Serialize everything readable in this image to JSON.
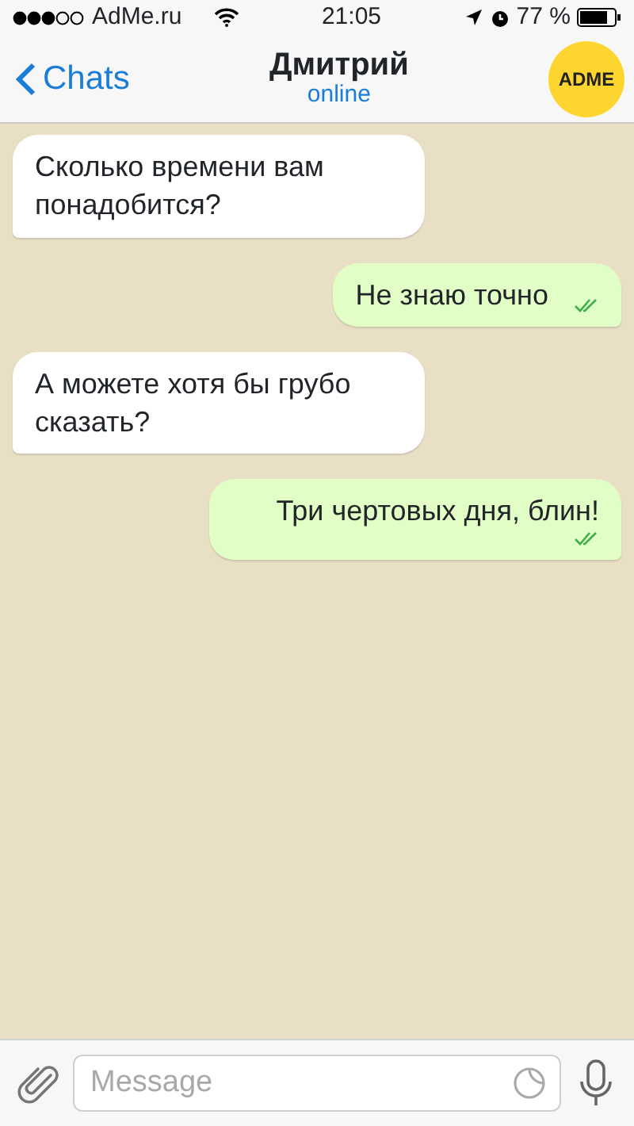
{
  "status_bar": {
    "carrier": "AdMe.ru",
    "time": "21:05",
    "battery": "77 %"
  },
  "nav": {
    "back": "Chats",
    "title": "Дмитрий",
    "subtitle": "online",
    "avatar": "ADME"
  },
  "messages": [
    {
      "kind": "in",
      "text": "Сколько времени вам понадобится?"
    },
    {
      "kind": "out",
      "text": "Не знаю точно",
      "read": true
    },
    {
      "kind": "in",
      "text": "А можете хотя бы грубо сказать?"
    },
    {
      "kind": "out",
      "text": "Три чертовых дня, блин!",
      "read": true
    }
  ],
  "composer": {
    "placeholder": "Message"
  }
}
